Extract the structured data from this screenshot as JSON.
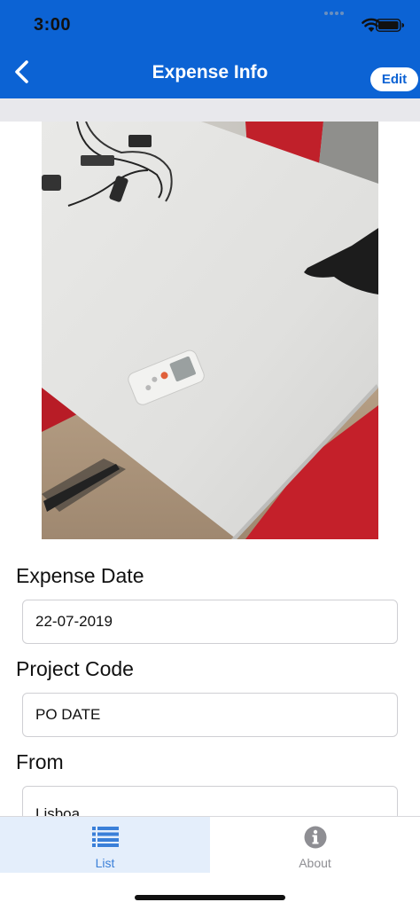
{
  "status_bar": {
    "time": "3:00",
    "icons": [
      "signal-icon",
      "wifi-icon",
      "battery-icon"
    ]
  },
  "nav": {
    "back_icon": "chevron-left-icon",
    "title": "Expense Info",
    "edit_label": "Edit"
  },
  "receipt_photo": {
    "description_icon": "photo"
  },
  "form": {
    "fields": [
      {
        "label": "Expense Date",
        "value": "22-07-2019"
      },
      {
        "label": "Project Code",
        "value": "PO DATE"
      },
      {
        "label": "From",
        "value": "Lisboa"
      }
    ]
  },
  "tab_bar": {
    "tabs": [
      {
        "label": "List",
        "icon": "list-icon",
        "active": true
      },
      {
        "label": "About",
        "icon": "info-icon",
        "active": false
      }
    ]
  },
  "colors": {
    "header": "#0c63d4",
    "active_tab_bg": "#e4eefb",
    "active_tab_text": "#3a7fd8",
    "inactive_tab_text": "#8e8e93"
  }
}
